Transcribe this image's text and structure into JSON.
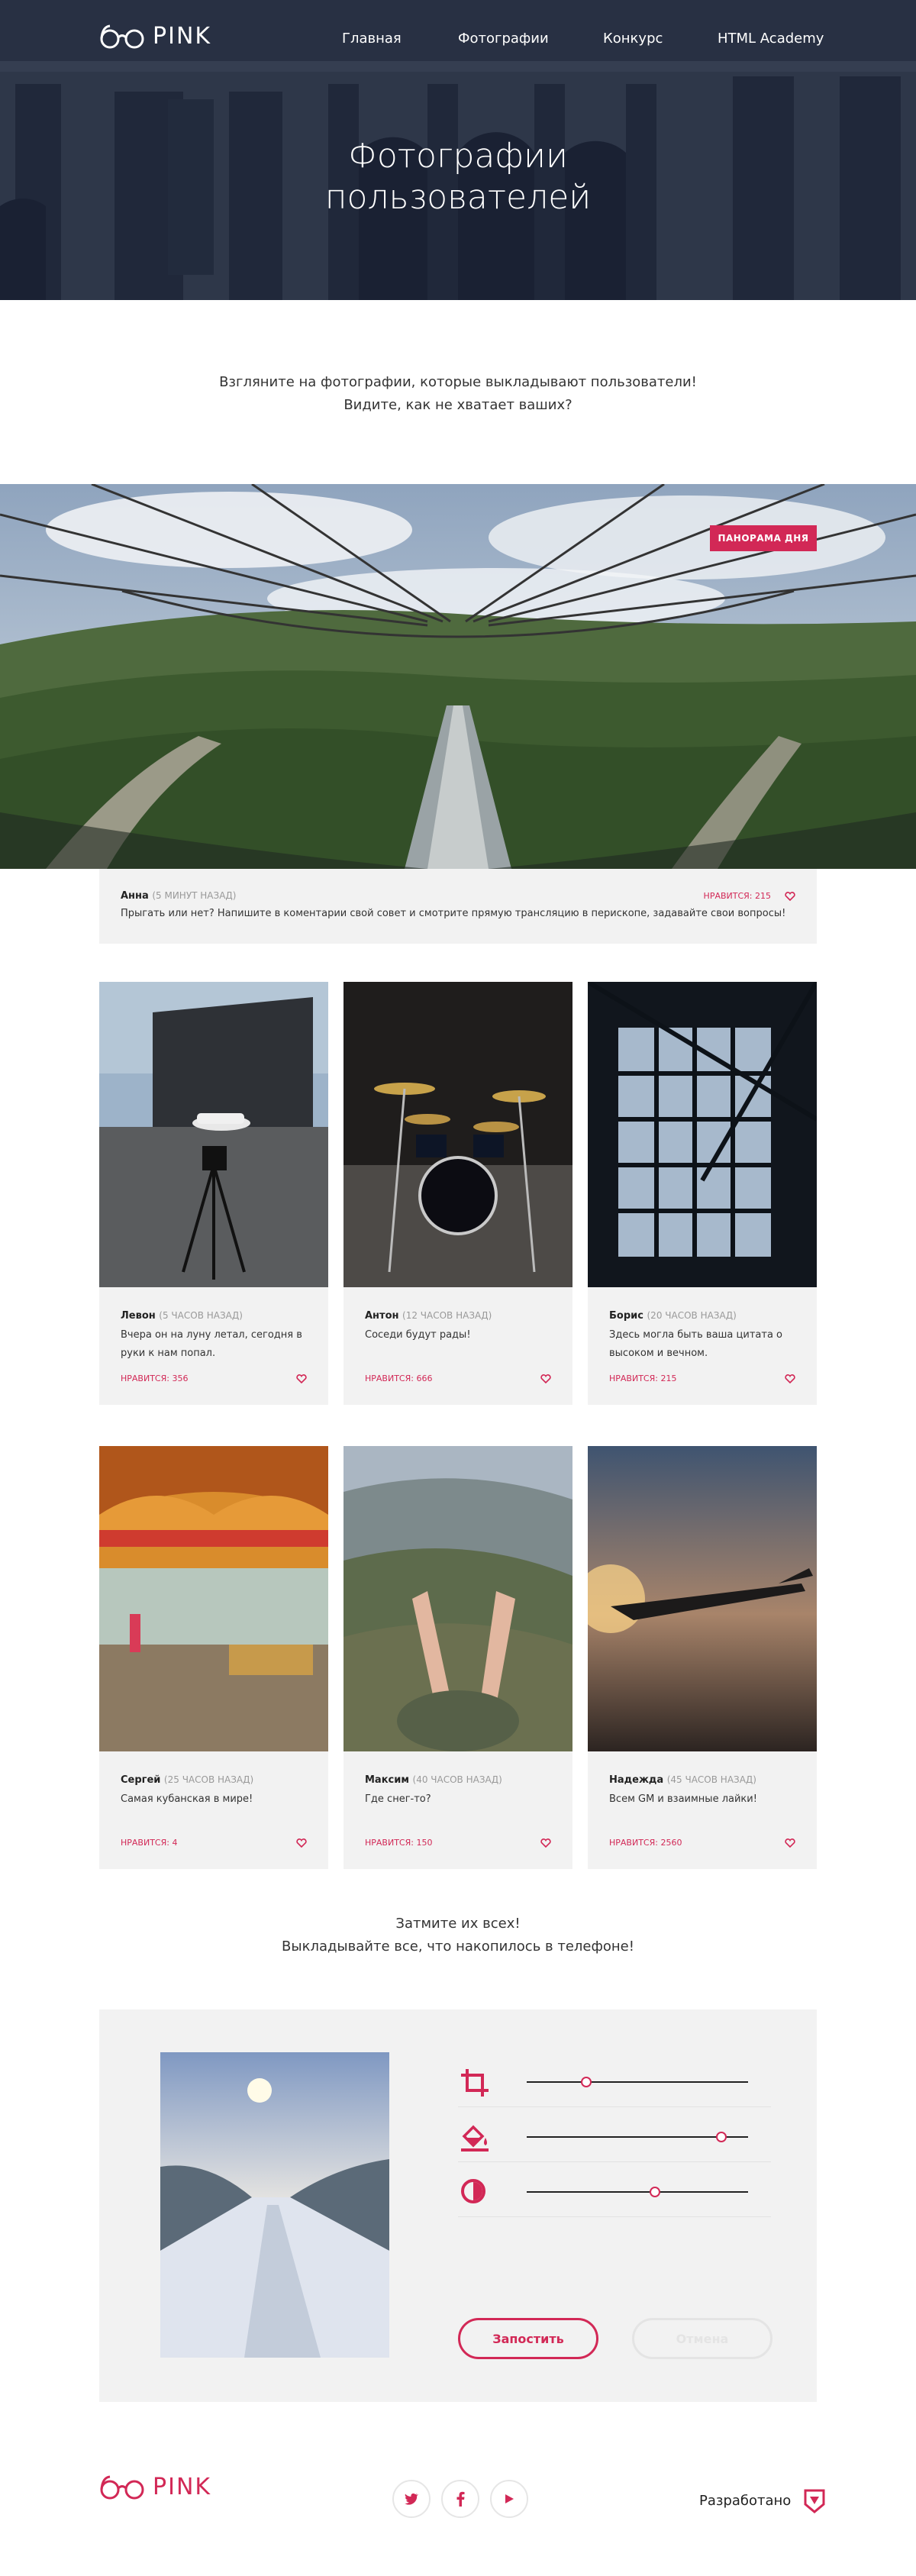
{
  "header": {
    "logo_text": "PINK",
    "nav": [
      "Главная",
      "Фотографии",
      "Конкурс",
      "HTML Academy"
    ],
    "title_line1": "Фотографии",
    "title_line2": "пользователей"
  },
  "intro": {
    "line1": "Взгляните на фотографии, которые выкладывают пользователи!",
    "line2": "Видите, как не хватает ваших?"
  },
  "panorama": {
    "badge": "ПАНОРАМА ДНЯ",
    "author": "Анна",
    "time": "(5 МИНУТ НАЗАД)",
    "likes": "НРАВИТСЯ: 215",
    "caption": "Прыгать или нет? Напишите в коментарии свой совет и смотрите прямую трансляцию в перископе, задавайте свои вопросы!"
  },
  "cards": [
    {
      "author": "Левон",
      "time": "(5 ЧАСОВ НАЗАД)",
      "caption": "Вчера он на луну летал, сегодня в руки к нам попал.",
      "likes": "НРАВИТСЯ: 356"
    },
    {
      "author": "Антон",
      "time": "(12 ЧАСОВ НАЗАД)",
      "caption": "Соседи будут рады!",
      "likes": "НРАВИТСЯ: 666"
    },
    {
      "author": "Борис",
      "time": "(20 ЧАСОВ НАЗАД)",
      "caption": "Здесь могла быть ваша цитата о высоком и вечном.",
      "likes": "НРАВИТСЯ: 215"
    },
    {
      "author": "Сергей",
      "time": "(25 ЧАСОВ НАЗАД)",
      "caption": "Самая кубанская в мире!",
      "likes": "НРАВИТСЯ: 4"
    },
    {
      "author": "Максим",
      "time": "(40 ЧАСОВ НАЗАД)",
      "caption": "Где снег-то?",
      "likes": "НРАВИТСЯ: 150"
    },
    {
      "author": "Надежда",
      "time": "(45 ЧАСОВ НАЗАД)",
      "caption": "Всем GM и взаимные лайки!",
      "likes": "НРАВИТСЯ: 2560"
    }
  ],
  "cta": {
    "line1": "Затмите их всех!",
    "line2": "Выкладывайте все, что накопилось в телефоне!"
  },
  "editor": {
    "tools": [
      {
        "icon": "crop-icon",
        "level": 0.27
      },
      {
        "icon": "fill-icon",
        "level": 0.88
      },
      {
        "icon": "contrast-icon",
        "level": 0.58
      }
    ],
    "submit": "Запостить",
    "cancel": "Отмена"
  },
  "footer": {
    "logo_text": "PINK",
    "social": [
      "twitter-icon",
      "facebook-icon",
      "youtube-icon"
    ],
    "dev_label": "Разработано"
  },
  "colors": {
    "accent": "#d22856",
    "card": "#f2f2f2",
    "hero_overlay": "#1d2635"
  }
}
